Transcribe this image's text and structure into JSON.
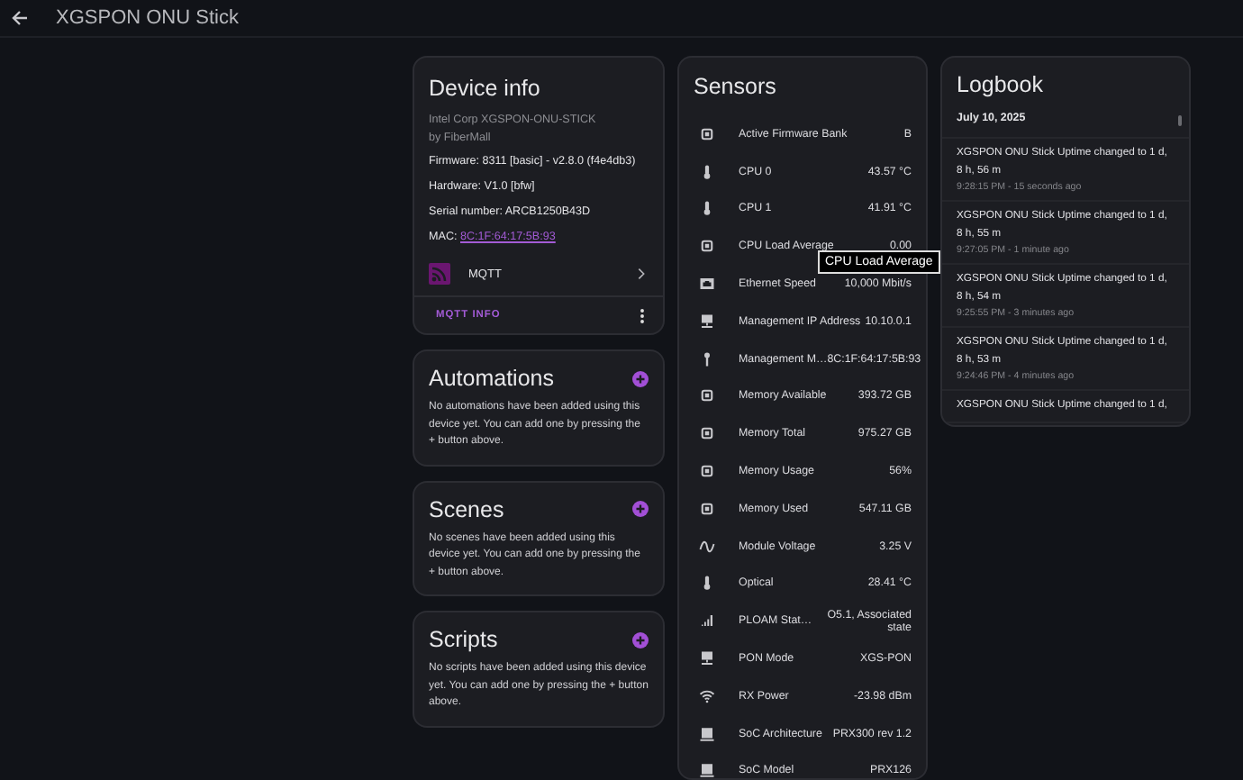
{
  "header": {
    "title": "XGSPON ONU Stick"
  },
  "device_info": {
    "title": "Device info",
    "model": "Intel Corp XGSPON-ONU-STICK",
    "manufacturer": "by FiberMall",
    "firmware": "Firmware: 8311 [basic] - v2.8.0 (f4e4db3)",
    "hardware": "Hardware: V1.0 [bfw]",
    "serial": "Serial number: ARCB1250B43D",
    "mac_label": "MAC:",
    "mac": "8C:1F:64:17:5B:93",
    "integration": "MQTT",
    "action": "MQTT INFO"
  },
  "cards": [
    {
      "title": "Automations",
      "text": "No automations have been added using this device yet. You can add one by pressing the + button above."
    },
    {
      "title": "Scenes",
      "text": "No scenes have been added using this device yet. You can add one by pressing the + button above."
    },
    {
      "title": "Scripts",
      "text": "No scripts have been added using this device yet. You can add one by pressing the + button above."
    }
  ],
  "sensors": {
    "title": "Sensors",
    "items": [
      {
        "kind": "chip",
        "name": "Active Firmware Bank",
        "value": "B"
      },
      {
        "kind": "thermometer",
        "name": "CPU 0",
        "value": "43.57 °C"
      },
      {
        "kind": "thermometer",
        "name": "CPU 1",
        "value": "41.91 °C"
      },
      {
        "kind": "chip",
        "name": "CPU Load Average",
        "value": "0.00"
      },
      {
        "kind": "ethernet",
        "name": "Ethernet Speed",
        "value": "10,000 Mbit/s"
      },
      {
        "kind": "network",
        "name": "Management IP Address",
        "value": "10.10.0.1"
      },
      {
        "kind": "key",
        "name": "Management M…",
        "value": "8C:1F:64:17:5B:93"
      },
      {
        "kind": "chip",
        "name": "Memory Available",
        "value": "393.72 GB"
      },
      {
        "kind": "chip",
        "name": "Memory Total",
        "value": "975.27 GB"
      },
      {
        "kind": "chip",
        "name": "Memory Usage",
        "value": "56%"
      },
      {
        "kind": "chip",
        "name": "Memory Used",
        "value": "547.11 GB"
      },
      {
        "kind": "wave",
        "name": "Module Voltage",
        "value": "3.25 V"
      },
      {
        "kind": "thermometer",
        "name": "Optical",
        "value": "28.41 °C"
      },
      {
        "kind": "signal",
        "name": "PLOAM Stat…",
        "value": "O5.1, Associated state"
      },
      {
        "kind": "network",
        "name": "PON Mode",
        "value": "XGS-PON"
      },
      {
        "kind": "wifi",
        "name": "RX Power",
        "value": "-23.98 dBm"
      },
      {
        "kind": "server",
        "name": "SoC Architecture",
        "value": "PRX300 rev 1.2"
      },
      {
        "kind": "server",
        "name": "SoC Model",
        "value": "PRX126"
      }
    ]
  },
  "tooltip": "CPU Load Average",
  "logbook": {
    "title": "Logbook",
    "date": "July 10, 2025",
    "entries": [
      {
        "message": "XGSPON ONU Stick Uptime changed to 1 d, 8 h, 56 m",
        "time": "9:28:15 PM - 15 seconds ago"
      },
      {
        "message": "XGSPON ONU Stick Uptime changed to 1 d, 8 h, 55 m",
        "time": "9:27:05 PM - 1 minute ago"
      },
      {
        "message": "XGSPON ONU Stick Uptime changed to 1 d, 8 h, 54 m",
        "time": "9:25:55 PM - 3 minutes ago"
      },
      {
        "message": "XGSPON ONU Stick Uptime changed to 1 d, 8 h, 53 m",
        "time": "9:24:46 PM - 4 minutes ago"
      },
      {
        "message": "XGSPON ONU Stick Uptime changed to 1 d,"
      }
    ]
  }
}
